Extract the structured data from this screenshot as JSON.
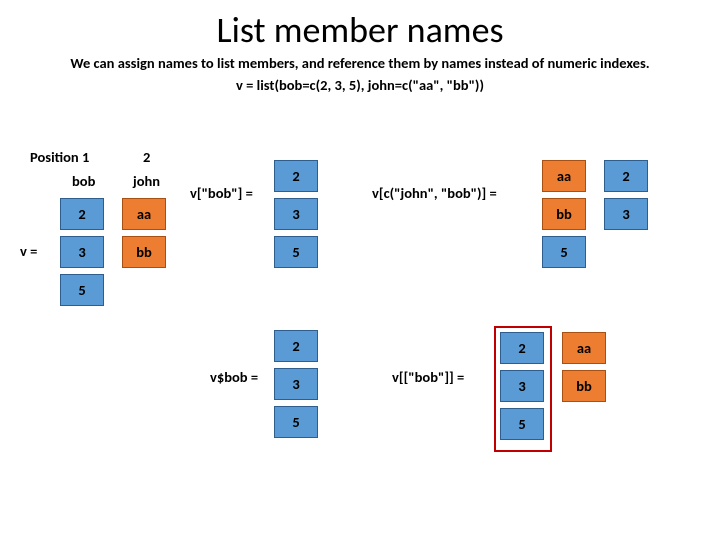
{
  "title": "List member names",
  "subtitle": "We can assign names to list members, and reference them by names instead of numeric indexes.",
  "code_line": "v = list(bob=c(2, 3, 5), john=c(\"aa\", \"bb\"))",
  "left": {
    "position_label": "Position 1",
    "position2": "2",
    "name_bob": "bob",
    "name_john": "john",
    "v_equals": "v =",
    "bob_vals": [
      "2",
      "3",
      "5"
    ],
    "john_vals": [
      "aa",
      "bb"
    ]
  },
  "r1": {
    "label": "v[\"bob\"] =",
    "vals": [
      "2",
      "3",
      "5"
    ]
  },
  "r2": {
    "label": "v[c(\"john\", \"bob\")] =",
    "john_name": "aa",
    "john_name2": "bb",
    "col1": [
      "2",
      "3",
      "5"
    ],
    "col_john": [
      "aa",
      "bb"
    ]
  },
  "r3": {
    "label": "v$bob =",
    "vals": [
      "2",
      "3",
      "5"
    ]
  },
  "r4": {
    "label": "v[[\"bob\"]] =",
    "col_bob": [
      "2",
      "3",
      "5"
    ],
    "col_john": [
      "aa",
      "bb"
    ]
  }
}
